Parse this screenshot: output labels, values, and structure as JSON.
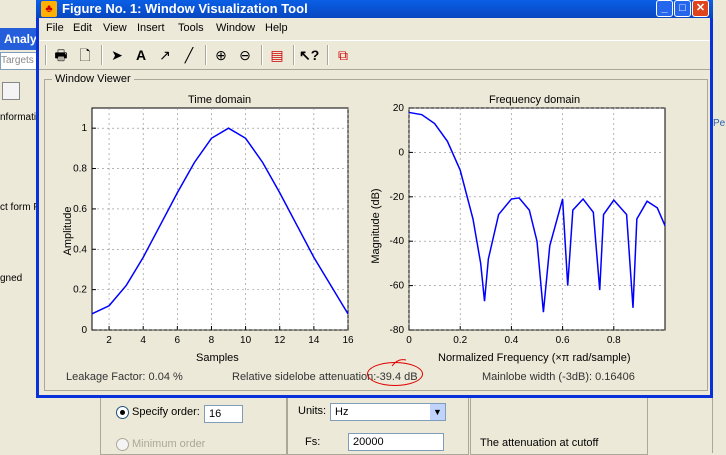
{
  "background_app": {
    "title_fragment": "Analy",
    "target_fragment": "Targets",
    "left_labels": [
      "nformati",
      "ct form F",
      "gned"
    ],
    "right_label": "Pe",
    "specify_order_label": "Specify order:",
    "order_value": "16",
    "minimum_order_label": "Minimum order",
    "units_label": "Units:",
    "units_value": "Hz",
    "fs_label": "Fs:",
    "fs_value": "20000",
    "attenuation_text": "The attenuation at cutoff"
  },
  "window": {
    "title": "Figure No. 1: Window Visualization Tool",
    "menu": [
      "File",
      "Edit",
      "View",
      "Insert",
      "Tools",
      "Window",
      "Help"
    ],
    "viewer_label": "Window Viewer"
  },
  "plots": {
    "time_title": "Time domain",
    "freq_title": "Frequency domain",
    "time_xlabel": "Samples",
    "time_ylabel": "Amplitude",
    "freq_xlabel": "Normalized Frequency  (×π rad/sample)",
    "freq_ylabel": "Magnitude (dB)"
  },
  "status": {
    "leakage": "Leakage Factor: 0.04 %",
    "sidelobe_label": "Relative sidelobe attenuation:",
    "sidelobe_value": "-39.4 dB",
    "mainlobe": "Mainlobe width (-3dB): 0.16406"
  },
  "colors": {
    "line": "#0000ff",
    "annotation": "#e00000",
    "titlebar": "#0a5fe6"
  },
  "chart_data": [
    {
      "type": "line",
      "title": "Time domain",
      "xlabel": "Samples",
      "ylabel": "Amplitude",
      "xlim": [
        1,
        16
      ],
      "ylim": [
        0,
        1.1
      ],
      "xticks": [
        2,
        4,
        6,
        8,
        10,
        12,
        14,
        16
      ],
      "yticks": [
        0,
        0.2,
        0.4,
        0.6,
        0.8,
        1
      ],
      "grid": true,
      "x": [
        1,
        2,
        3,
        4,
        5,
        6,
        7,
        8,
        9,
        10,
        11,
        12,
        13,
        14,
        15,
        16
      ],
      "y": [
        0.08,
        0.12,
        0.22,
        0.36,
        0.52,
        0.68,
        0.83,
        0.95,
        1.0,
        0.95,
        0.83,
        0.68,
        0.52,
        0.36,
        0.22,
        0.08
      ]
    },
    {
      "type": "line",
      "title": "Frequency domain",
      "xlabel": "Normalized Frequency  (×π rad/sample)",
      "ylabel": "Magnitude (dB)",
      "xlim": [
        0,
        1
      ],
      "ylim": [
        -80,
        20
      ],
      "xticks": [
        0,
        0.2,
        0.4,
        0.6,
        0.8
      ],
      "yticks": [
        20,
        0,
        -20,
        -40,
        -60,
        -80
      ],
      "grid": true,
      "x": [
        0,
        0.05,
        0.1,
        0.15,
        0.2,
        0.25,
        0.28,
        0.295,
        0.31,
        0.35,
        0.4,
        0.43,
        0.47,
        0.5,
        0.525,
        0.55,
        0.6,
        0.62,
        0.64,
        0.68,
        0.72,
        0.745,
        0.76,
        0.8,
        0.85,
        0.875,
        0.89,
        0.93,
        0.97,
        1.0
      ],
      "y": [
        18,
        17,
        13,
        5,
        -8,
        -30,
        -50,
        -67,
        -48,
        -28,
        -21,
        -20.5,
        -26,
        -40,
        -72,
        -42,
        -21,
        -60,
        -26,
        -21,
        -27,
        -62,
        -28,
        -21.5,
        -28,
        -70,
        -30,
        -22,
        -25,
        -33
      ]
    }
  ]
}
